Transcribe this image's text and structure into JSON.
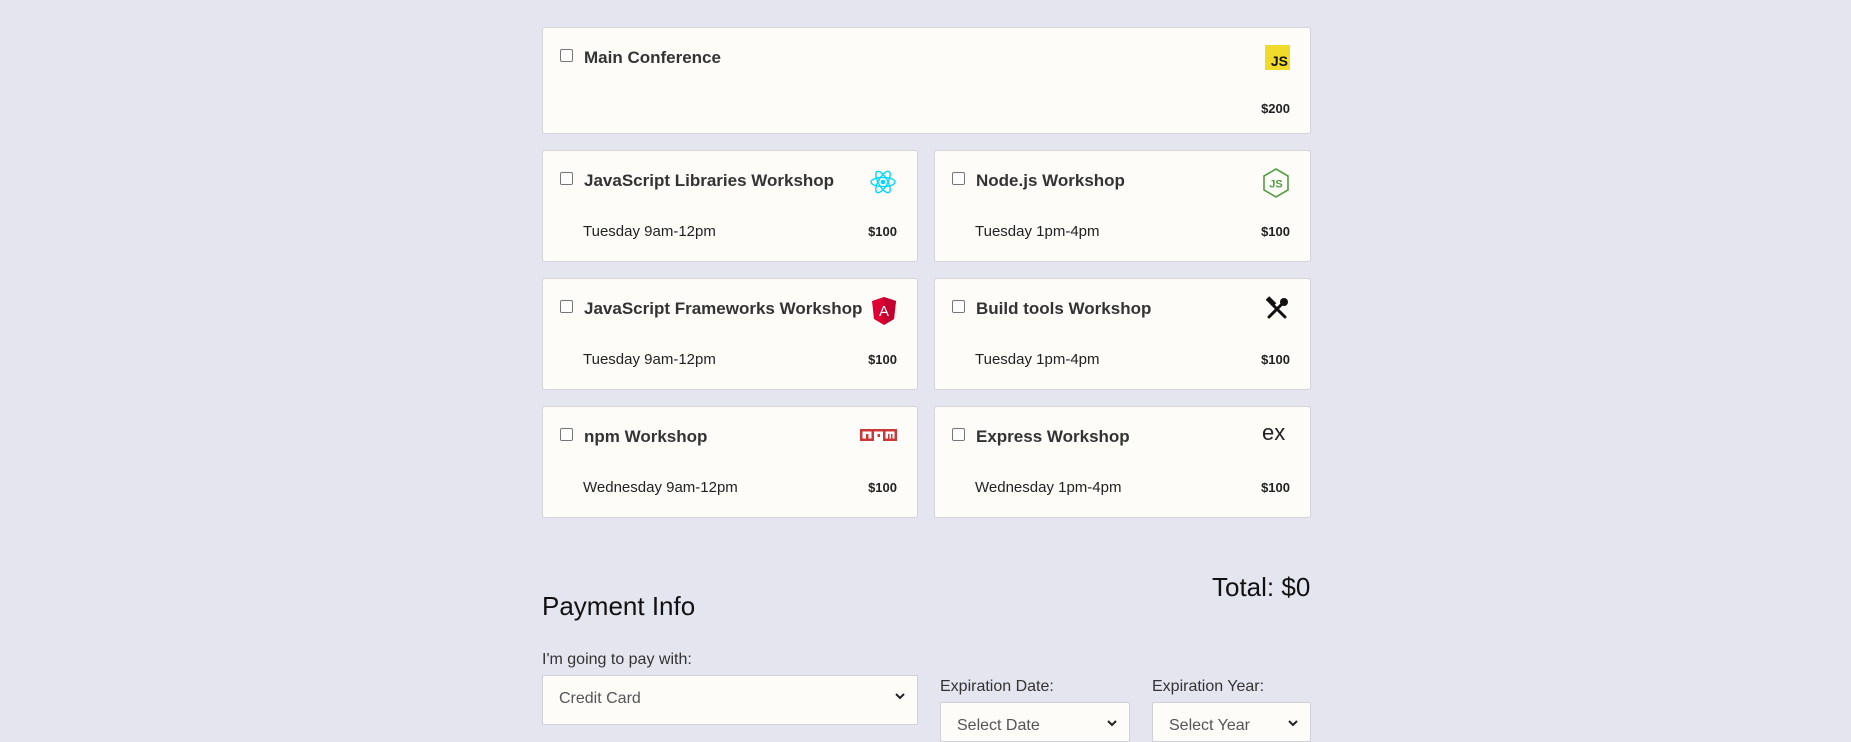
{
  "activities": {
    "main": {
      "name": "Main Conference",
      "price": "$200",
      "icon": "javascript-icon",
      "logo_text": "JS"
    },
    "workshops": [
      {
        "name": "JavaScript Libraries Workshop",
        "time": "Tuesday 9am-12pm",
        "price": "$100",
        "icon": "react-icon"
      },
      {
        "name": "Node.js Workshop",
        "time": "Tuesday 1pm-4pm",
        "price": "$100",
        "icon": "nodejs-icon"
      },
      {
        "name": "JavaScript Frameworks Workshop",
        "time": "Tuesday 9am-12pm",
        "price": "$100",
        "icon": "angular-icon"
      },
      {
        "name": "Build tools Workshop",
        "time": "Tuesday 1pm-4pm",
        "price": "$100",
        "icon": "tools-icon"
      },
      {
        "name": "npm Workshop",
        "time": "Wednesday 9am-12pm",
        "price": "$100",
        "icon": "npm-icon"
      },
      {
        "name": "Express Workshop",
        "time": "Wednesday 1pm-4pm",
        "price": "$100",
        "icon": "express-icon"
      }
    ],
    "total": "Total: $0"
  },
  "payment": {
    "title": "Payment Info",
    "method_label": "I'm going to pay with:",
    "method_value": "Credit Card",
    "exp_date_label": "Expiration Date:",
    "exp_date_value": "Select Date",
    "exp_year_label": "Expiration Year:",
    "exp_year_value": "Select Year"
  },
  "colors": {
    "background": "#e5e5f0",
    "card": "#fefcf8",
    "js_yellow": "#f0db2a",
    "react": "#00d8ff",
    "node": "#539e43",
    "angular": "#dd0031",
    "npm": "#cb3837"
  }
}
